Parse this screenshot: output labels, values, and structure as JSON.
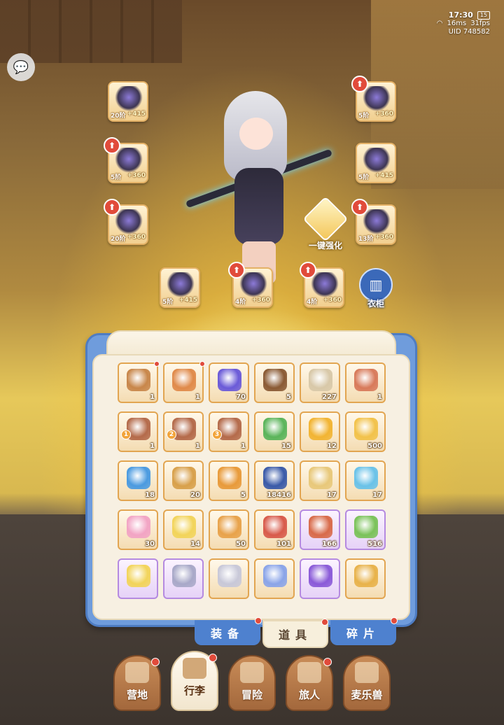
{
  "status": {
    "time": "17:30",
    "battery": "15",
    "ping": "16ms",
    "fps": "31fps",
    "uid": "UID 748582"
  },
  "chat_icon": "speech-bubble-icon",
  "equipment": [
    {
      "id": "weapon",
      "lvl": "20阶",
      "bonus": "+415",
      "badge": false
    },
    {
      "id": "helmet",
      "lvl": "5阶",
      "bonus": "+360",
      "badge": true
    },
    {
      "id": "armor",
      "lvl": "5阶",
      "bonus": "+360",
      "badge": true
    },
    {
      "id": "gloves",
      "lvl": "5阶",
      "bonus": "+415",
      "badge": false
    },
    {
      "id": "belt",
      "lvl": "20阶",
      "bonus": "+360",
      "badge": true
    },
    {
      "id": "boots",
      "lvl": "13阶",
      "bonus": "+360",
      "badge": true
    },
    {
      "id": "ring",
      "lvl": "5阶",
      "bonus": "+415",
      "badge": false
    },
    {
      "id": "necklace",
      "lvl": "4阶",
      "bonus": "+360",
      "badge": true
    },
    {
      "id": "amulet",
      "lvl": "4阶",
      "bonus": "+360",
      "badge": true
    }
  ],
  "one_click_label": "一键强化",
  "wardrobe_label": "衣柜",
  "badge_glyph": "⬆",
  "items": [
    {
      "name": "treasure-chest",
      "qty": "1",
      "color": "#c8864a",
      "dot": true
    },
    {
      "name": "crystal-shard",
      "qty": "1",
      "color": "#e08a4a",
      "dot": true
    },
    {
      "name": "purple-ticket",
      "qty": "70",
      "color": "#6a5ad8",
      "dot": false
    },
    {
      "name": "wood-log",
      "qty": "5",
      "color": "#8a5a34",
      "dot": false
    },
    {
      "name": "spoon",
      "qty": "227",
      "color": "#d8c8a8",
      "dot": false
    },
    {
      "name": "cat-backpack",
      "qty": "1",
      "color": "#d87a5a",
      "dot": false
    },
    {
      "name": "chest-stage-1",
      "qty": "1",
      "color": "#b46a4a",
      "stage": "1",
      "dot": false
    },
    {
      "name": "chest-stage-2",
      "qty": "1",
      "color": "#b46a4a",
      "stage": "2",
      "dot": false
    },
    {
      "name": "chest-stage-3",
      "qty": "1",
      "color": "#b46a4a",
      "stage": "3",
      "dot": false
    },
    {
      "name": "paper-plane",
      "qty": "15",
      "color": "#5ab45a",
      "dot": false
    },
    {
      "name": "amber-gem",
      "qty": "12",
      "color": "#f2b432",
      "dot": false
    },
    {
      "name": "star-flower",
      "qty": "500",
      "color": "#f2c24a",
      "dot": false
    },
    {
      "name": "blue-potion",
      "qty": "18",
      "color": "#4a9ae0",
      "dot": false
    },
    {
      "name": "bell-hat",
      "qty": "20",
      "color": "#d8a04a",
      "dot": false
    },
    {
      "name": "cat-coin",
      "qty": "5",
      "color": "#e89a3a",
      "dot": false
    },
    {
      "name": "moon-stone",
      "qty": "18416",
      "color": "#3a5aa8",
      "dot": false
    },
    {
      "name": "harp",
      "qty": "17",
      "color": "#e8c87a",
      "dot": false
    },
    {
      "name": "ice-crystal",
      "qty": "17",
      "color": "#6ac2e8",
      "dot": false
    },
    {
      "name": "rainbow-potion",
      "qty": "30",
      "color": "#f2a4c4",
      "dot": false
    },
    {
      "name": "rainbow-tube",
      "qty": "14",
      "color": "#f2d45a",
      "dot": false
    },
    {
      "name": "gold-card",
      "qty": "50",
      "color": "#e8a24a",
      "dot": false
    },
    {
      "name": "red-bell",
      "qty": "101",
      "color": "#d85a4a",
      "dot": false
    },
    {
      "name": "horseshoe",
      "qty": "166",
      "color": "#d86a4a",
      "purple": true,
      "dot": false
    },
    {
      "name": "green-bottle",
      "qty": "516",
      "color": "#7ac25a",
      "purple": true,
      "dot": false
    },
    {
      "name": "yellow-blob",
      "qty": "",
      "color": "#f2d45a",
      "purple": true,
      "dot": false
    },
    {
      "name": "kitten-charm",
      "qty": "",
      "color": "#a8a8c8",
      "purple": true,
      "dot": false
    },
    {
      "name": "silver-orb",
      "qty": "",
      "color": "#c8c8d8",
      "dot": false
    },
    {
      "name": "blue-star",
      "qty": "",
      "color": "#8aa4e8",
      "dot": false
    },
    {
      "name": "purple-gem",
      "qty": "",
      "color": "#8a5ad8",
      "purple": true,
      "dot": false
    },
    {
      "name": "gold-egg",
      "qty": "",
      "color": "#e8b24a",
      "dot": false
    }
  ],
  "tabs": [
    {
      "label": "装备",
      "active": false,
      "dot": true
    },
    {
      "label": "道具",
      "active": true,
      "dot": true
    },
    {
      "label": "碎片",
      "active": false,
      "dot": true
    }
  ],
  "nav": [
    {
      "label": "营地",
      "icon": "castle-icon",
      "active": false,
      "dot": true
    },
    {
      "label": "行李",
      "icon": "suitcase-icon",
      "active": true,
      "dot": true
    },
    {
      "label": "冒险",
      "icon": "swords-icon",
      "active": false,
      "dot": false
    },
    {
      "label": "旅人",
      "icon": "traveler-icon",
      "active": false,
      "dot": true
    },
    {
      "label": "麦乐兽",
      "icon": "fox-icon",
      "active": false,
      "dot": false
    }
  ]
}
